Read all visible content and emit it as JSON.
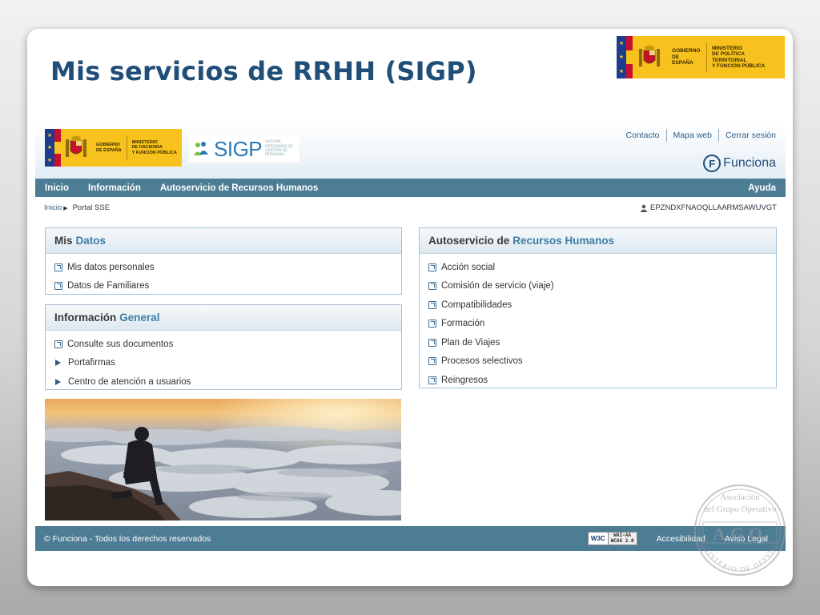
{
  "slide": {
    "title": "Mis servicios de RRHH (SIGP)",
    "logo_gobierno": "GOBIERNO\nDE ESPAÑA",
    "logo_ministerio": "MINISTERIO\nDE POLÍTICA TERRITORIAL\nY FUNCIÓN PÚBLICA"
  },
  "app": {
    "logo_gobierno": "GOBIERNO\nDE ESPAÑA",
    "logo_ministerio": "MINISTERIO\nDE HACIENDA\nY FUNCIÓN PÚBLICA",
    "sigp_word": "SIGP",
    "sigp_sub": "SISTEMA\nINTEGRADO DE\nGESTIÓN DE\nPERSONAL",
    "top_links": [
      "Contacto",
      "Mapa web",
      "Cerrar sesión"
    ],
    "funciona_brand": "Funciona",
    "funciona_letter": "F",
    "nav": {
      "items": [
        "Inicio",
        "Información",
        "Autoservicio de Recursos Humanos"
      ],
      "help": "Ayuda"
    },
    "breadcrumb": {
      "home": "Inicio",
      "current": "Portal SSE"
    },
    "user_id": "EPZNDXFNAOQLLAARMSAWUVGT",
    "panels": {
      "mis_datos": {
        "title_a": "Mis",
        "title_b": "Datos",
        "items": [
          "Mis datos personales",
          "Datos de Familiares"
        ]
      },
      "info_general": {
        "title_a": "Información",
        "title_b": "General",
        "items": [
          "Consulte sus documentos",
          "Portafirmas",
          "Centro de atención a usuarios"
        ]
      },
      "autoservicio": {
        "title_a": "Autoservicio de",
        "title_b": "Recursos Humanos",
        "items": [
          "Acción social",
          "Comisión de servicio (viaje)",
          "Compatibilidades",
          "Formación",
          "Plan de Viajes",
          "Procesos selectivos",
          "Reingresos"
        ]
      }
    },
    "footer": {
      "copyright": "© Funciona - Todos los derechos reservados",
      "w3c": "W3C",
      "wcag_1": "WAI-AA",
      "wcag_2": "WCAG 2.0",
      "links": [
        "Accesibilidad",
        "Aviso Legal"
      ]
    }
  },
  "stamp": {
    "line1": "Asociación",
    "line2": "del Grupo Operativo",
    "letters": "AGO",
    "ring": "MINISTERIO DE DEFENSA"
  },
  "colors": {
    "title": "#1f4e79",
    "nav_bar": "#4d7c95",
    "accent": "#3e7ea5",
    "gov_yellow": "#f7c21d",
    "gov_red": "#c8102e"
  }
}
